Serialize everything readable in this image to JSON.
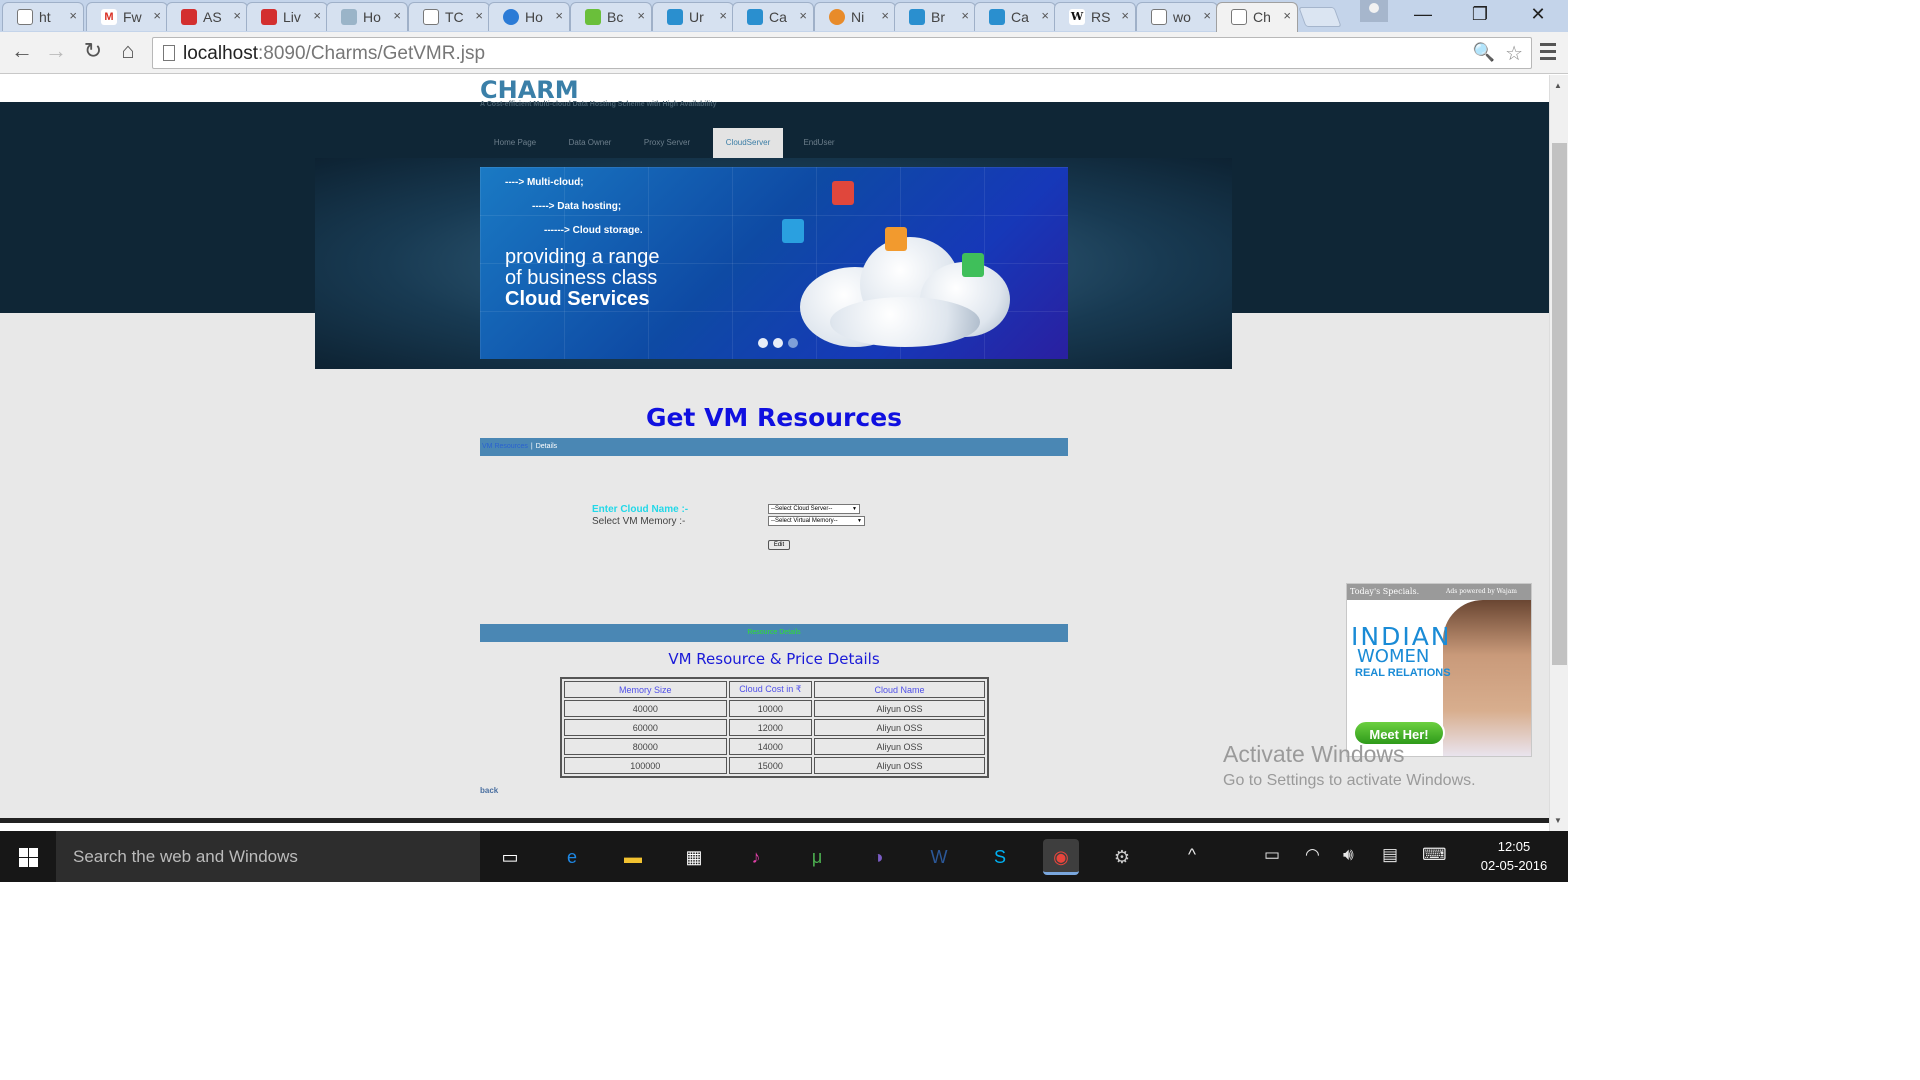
{
  "browser": {
    "tabs": [
      {
        "title": "ht",
        "icon": "document-icon",
        "active": false
      },
      {
        "title": "Fw",
        "icon": "gmail-icon",
        "active": false
      },
      {
        "title": "AS",
        "icon": "red-doc-icon",
        "active": false
      },
      {
        "title": "Liv",
        "icon": "red-doc-icon",
        "active": false
      },
      {
        "title": "Ho",
        "icon": "people-search-icon",
        "active": false
      },
      {
        "title": "TC",
        "icon": "document-icon",
        "active": false
      },
      {
        "title": "Ho",
        "icon": "blue-circle-icon",
        "active": false
      },
      {
        "title": "Bc",
        "icon": "green-leaf-icon",
        "active": false
      },
      {
        "title": "Ur",
        "icon": "cloud-logo-icon",
        "active": false
      },
      {
        "title": "Ca",
        "icon": "cloud-logo-icon",
        "active": false
      },
      {
        "title": "Ni",
        "icon": "colorful-flower-icon",
        "active": false
      },
      {
        "title": "Br",
        "icon": "cloud-logo-icon",
        "active": false
      },
      {
        "title": "Ca",
        "icon": "cloud-logo-icon",
        "active": false
      },
      {
        "title": "RS",
        "icon": "wikipedia-icon",
        "active": false
      },
      {
        "title": "wo",
        "icon": "document-icon",
        "active": false
      },
      {
        "title": "Ch",
        "icon": "document-icon",
        "active": true
      }
    ],
    "close_glyph": "×",
    "window_controls": {
      "minimize": "—",
      "restore": "❐",
      "close": "✕"
    },
    "nav": {
      "back": "←",
      "forward": "→",
      "reload": "↻",
      "home": "⌂"
    },
    "url_host": "localhost",
    "url_rest": ":8090/Charms/GetVMR.jsp",
    "zoom_glyph": "🔍",
    "star_glyph": "☆"
  },
  "site": {
    "title": "CHARM",
    "subtitle": "A Cost-efficient Multi-cloud Data Hosting Scheme with High Availability",
    "nav_items": [
      {
        "label": "Home Page",
        "active": false
      },
      {
        "label": "Data Owner",
        "active": false
      },
      {
        "label": "Proxy Server",
        "active": false
      },
      {
        "label": "CloudServer",
        "active": true
      },
      {
        "label": "EndUser",
        "active": false
      }
    ],
    "banner": {
      "line1": "----> Multi-cloud;",
      "line2": "-----> Data hosting;",
      "line3": "------> Cloud storage.",
      "headline1": "providing a range",
      "headline2": "of business class",
      "headline3": "Cloud Services"
    }
  },
  "main": {
    "heading": "Get VM Resources",
    "breadcrumb_link": "VM Resources",
    "breadcrumb_sep": "|",
    "breadcrumb_current": "Details",
    "form": {
      "cloud_label": "Enter Cloud Name :-",
      "memory_label": "Select VM Memory :-",
      "cloud_select": "--Select Cloud Server--",
      "memory_select": "--Select Virtual Memory--",
      "edit_button": "Edit"
    },
    "resource_bar": "Resource Details",
    "table_caption": "VM Resource & Price Details",
    "table": {
      "headers": [
        "Memory Size",
        "Cloud Cost in ₹",
        "Cloud Name"
      ],
      "rows": [
        [
          "40000",
          "10000",
          "Aliyun OSS"
        ],
        [
          "60000",
          "12000",
          "Aliyun OSS"
        ],
        [
          "80000",
          "14000",
          "Aliyun OSS"
        ],
        [
          "100000",
          "15000",
          "Aliyun OSS"
        ]
      ]
    },
    "back_link": "back"
  },
  "ad": {
    "header_left": "Today's Specials.",
    "header_right": "Ads powered by Wajam",
    "line1": "INDIAN",
    "line2": "WOMEN",
    "line3": "REAL RELATIONS",
    "cta": "Meet Her!"
  },
  "watermark": {
    "line1": "Activate Windows",
    "line2": "Go to Settings to activate Windows."
  },
  "taskbar": {
    "search_placeholder": "Search the web and Windows",
    "time": "12:05",
    "date": "02-05-2016",
    "tray_up": "^",
    "apps": [
      {
        "name": "task-view-icon",
        "glyph": "▭",
        "color": "#ffffff"
      },
      {
        "name": "edge-icon",
        "glyph": "e",
        "color": "#1e88e5"
      },
      {
        "name": "file-explorer-icon",
        "glyph": "▬",
        "color": "#f2c230"
      },
      {
        "name": "store-icon",
        "glyph": "▦",
        "color": "#ffffff"
      },
      {
        "name": "itunes-icon",
        "glyph": "♪",
        "color": "#e040a8"
      },
      {
        "name": "utorrent-icon",
        "glyph": "μ",
        "color": "#4caf50"
      },
      {
        "name": "eclipse-icon",
        "glyph": "◑",
        "color": "#7a5cc4"
      },
      {
        "name": "word-icon",
        "glyph": "W",
        "color": "#2b5797"
      },
      {
        "name": "skype-icon",
        "glyph": "S",
        "color": "#00aff0"
      },
      {
        "name": "chrome-icon",
        "glyph": "◉",
        "color": "#e8453c"
      },
      {
        "name": "settings-gear-icon",
        "glyph": "⚙",
        "color": "#cccccc"
      }
    ]
  }
}
